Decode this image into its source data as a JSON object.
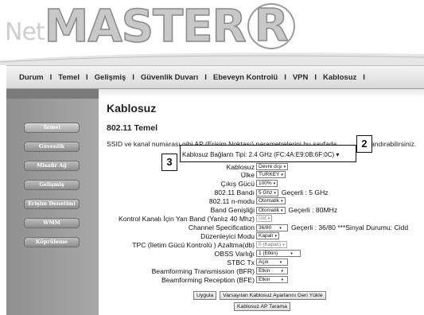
{
  "logo": {
    "prefix": "Net",
    "brand": "MASTER",
    "registered": "R"
  },
  "nav": {
    "items": [
      "Durum",
      "Temel",
      "Gelişmiş",
      "Güvenlik Duvarı",
      "Ebeveyn Kontrolü",
      "VPN",
      "Kablosuz"
    ],
    "separator": "I"
  },
  "sidebar": {
    "items": [
      "Temel",
      "Güvenlik",
      "Misafir Ağ",
      "Gelişmiş",
      "Erişim Denetimi",
      "WMM",
      "Köprüleme"
    ],
    "active_index": 0
  },
  "page": {
    "title": "Kablosuz",
    "section": "802.11 Temel",
    "intro": "SSID ve kanal numarası gibi AP (Erişim Noktası) parametrelerini bu sayfada",
    "intro_tail": "andırabilirsiniz."
  },
  "highlight_box": {
    "line1": "Kablosuz Bağlantı Tipi: 2.4 GHz (FC:4A:E9:0B:6F:0C) ▾"
  },
  "form": {
    "kablosuz": {
      "label": "Kablosuz",
      "value": "Devre dışı"
    },
    "ulke": {
      "label": "Ülke",
      "value": "TURKEY"
    },
    "cikis_gucu": {
      "label": "Çıkış Gücü",
      "value": "100%"
    },
    "band": {
      "label": "802.11 Bandı",
      "value": "5 Ghz",
      "note": "Geçerli :  5 GHz"
    },
    "n_modu": {
      "label": "802.11 n-modu",
      "value": "Otomatik"
    },
    "band_genisligi": {
      "label": "Band Genişliği",
      "value": "Otomatik",
      "note": "Geçerli :  80MHz"
    },
    "yan_band": {
      "label": "Kontrol Kanalı İçin Yan Band (Yanlız 40 Mhz)",
      "value": "Üst"
    },
    "channel_spec": {
      "label": "Channel Specification",
      "value": "36/80",
      "note": "Geçerli :  36/80 ***Sinyal Durumu: Cidd"
    },
    "duzenleyici": {
      "label": "Düzenleyici Modu",
      "value": "Kapalı"
    },
    "tpc": {
      "label": "TPC (İletim Gücü Kontrolü ) Azaltma(db)",
      "value": "0 (Kapalı)"
    },
    "obss": {
      "label": "OBSS Varlığı",
      "value": "1 (Etkin)"
    },
    "stbc": {
      "label": "STBC Tx",
      "value": "Açık"
    },
    "bfr_tx": {
      "label": "Beamforming Transmission (BFR)",
      "value": "Etkin"
    },
    "bfr_rx": {
      "label": "Beamforming Reception (BFE)",
      "value": "Etkin"
    }
  },
  "buttons": {
    "apply": "Uygula",
    "restore": "Varsayılan Kablosuz Ayarlarını Geri Yükle",
    "scan": "Kablosuz AP Tarama"
  },
  "callouts": {
    "two": "2",
    "three": "3"
  },
  "icons": {
    "dropdown": "chevron-down-icon"
  }
}
